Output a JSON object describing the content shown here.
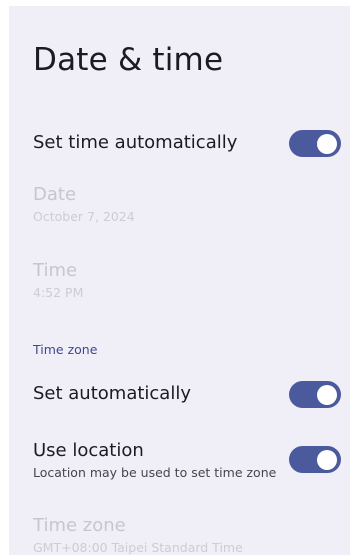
{
  "page": {
    "title": "Date & time"
  },
  "settings": {
    "set_time_automatically": {
      "label": "Set time automatically",
      "enabled": true
    },
    "date": {
      "label": "Date",
      "value": "October 7, 2024"
    },
    "time": {
      "label": "Time",
      "value": "4:52 PM"
    },
    "time_zone_section": {
      "header": "Time zone"
    },
    "set_automatically": {
      "label": "Set automatically",
      "enabled": true
    },
    "use_location": {
      "label": "Use location",
      "summary": "Location may be used to set time zone",
      "enabled": true
    },
    "time_zone": {
      "label": "Time zone",
      "value": "GMT+08:00 Taipei Standard Time"
    }
  },
  "colors": {
    "background": "#f0eef7",
    "accent": "#4a5a9c",
    "section_header": "#3d4a8c",
    "disabled_text": "#c7c6cf"
  }
}
